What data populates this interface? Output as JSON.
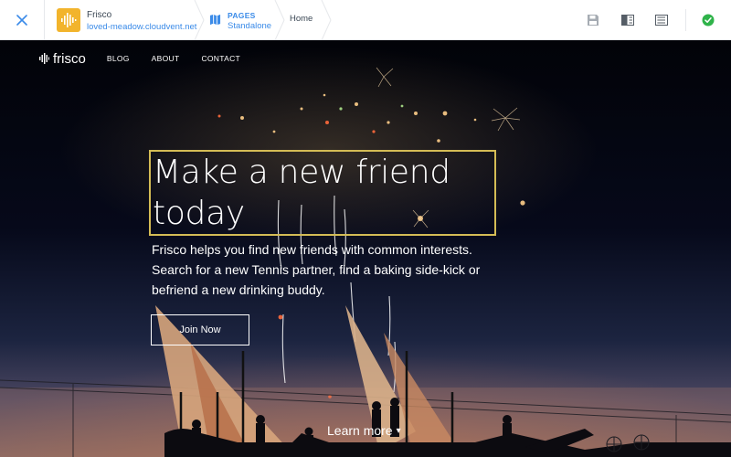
{
  "toolbar": {
    "close_icon": "close-icon",
    "site": {
      "name": "Frisco",
      "url": "loved-meadow.cloudvent.net",
      "badge_color": "#f2b42c",
      "icon": "waveform-icon"
    },
    "pages": {
      "label": "PAGES",
      "value": "Standalone",
      "icon": "map-icon"
    },
    "current_page": "Home",
    "actions": [
      {
        "name": "save",
        "icon": "save-icon"
      },
      {
        "name": "split-view",
        "icon": "split-view-icon"
      },
      {
        "name": "editor-view",
        "icon": "content-view-icon"
      },
      {
        "name": "status",
        "icon": "check-circle-icon",
        "color": "#2fb34a"
      }
    ],
    "accent_color": "#3b8be8"
  },
  "hero": {
    "nav": {
      "logo": "frisco",
      "links": [
        "BLOG",
        "ABOUT",
        "CONTACT"
      ]
    },
    "headline": "Make a new friend today",
    "lede": "Frisco helps you find new friends with common interests. Search for a new Tennis partner, find a baking side-kick or befriend a new drinking buddy.",
    "cta_label": "Join Now",
    "learn_more": "Learn more",
    "learn_more_caret": "▾",
    "selection_color": "#d4bc55"
  }
}
